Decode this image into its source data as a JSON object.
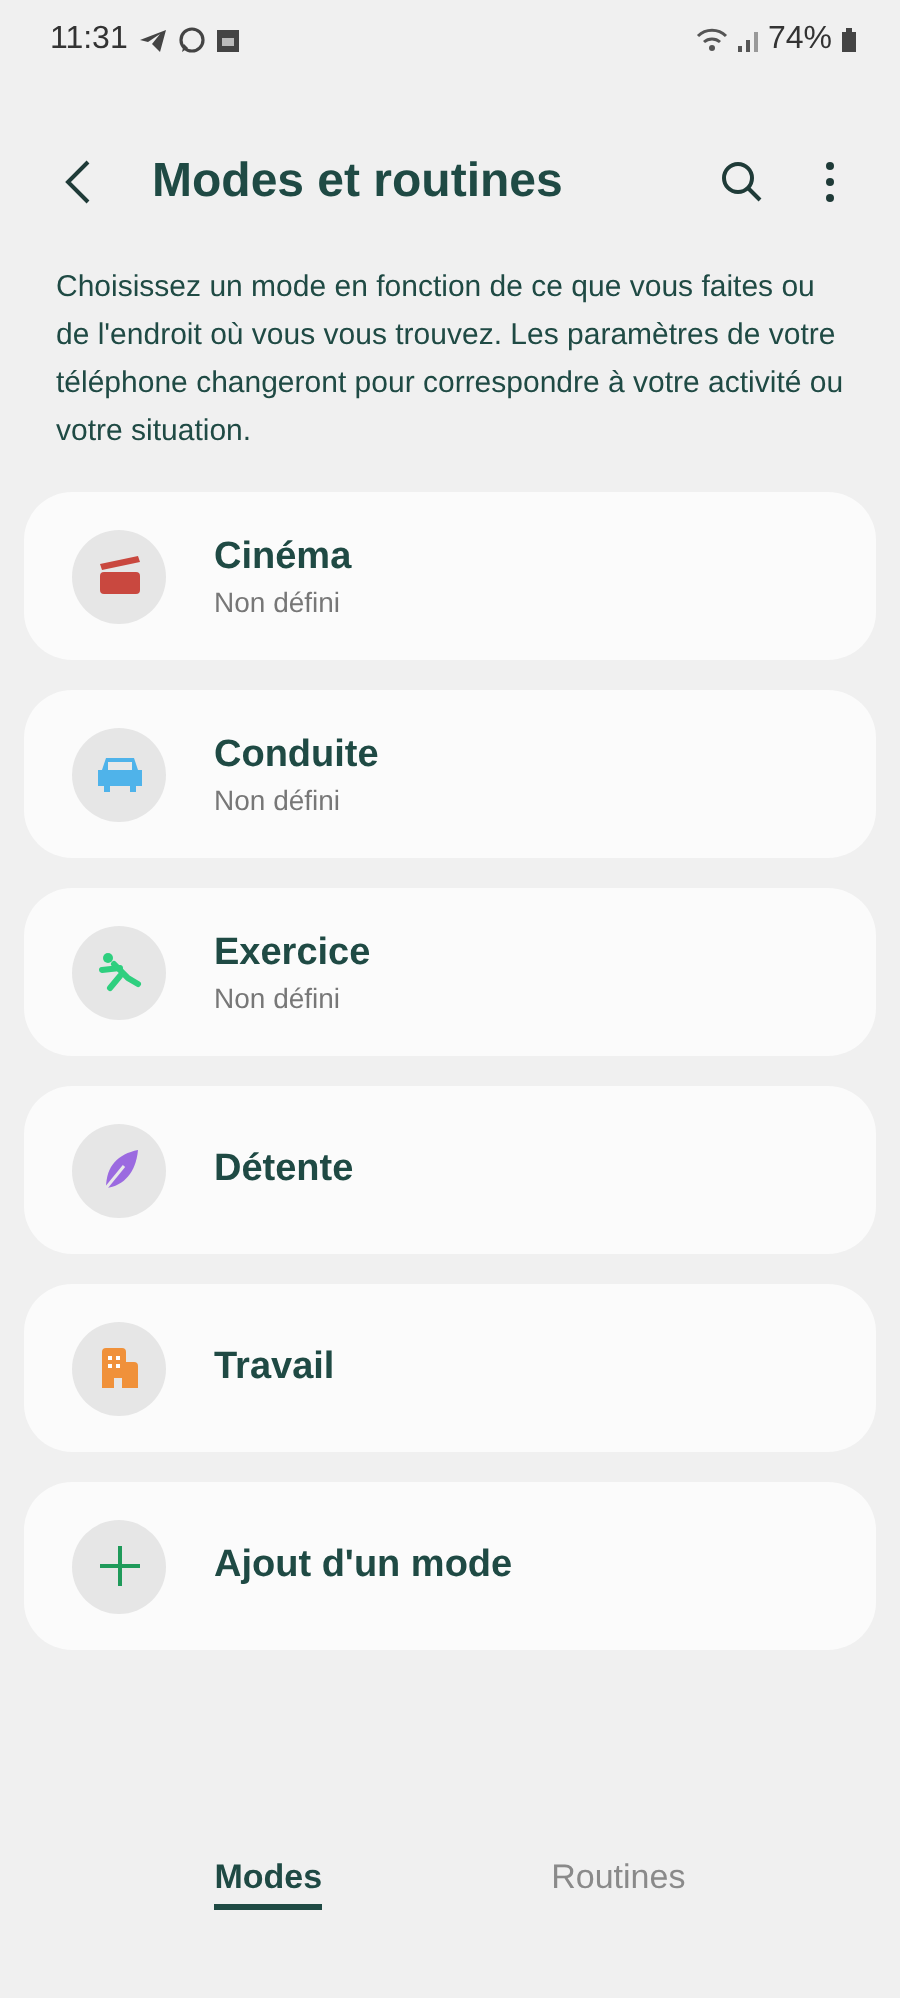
{
  "status_bar": {
    "time": "11:31",
    "battery": "74%"
  },
  "header": {
    "title": "Modes et routines"
  },
  "description": "Choisissez un mode en fonction de ce que vous faites ou de l'endroit où vous vous trouvez. Les paramètres de votre téléphone changeront pour correspondre à votre activité ou votre situation.",
  "modes": [
    {
      "kind": "cinema",
      "name": "Cinéma",
      "status": "Non défini",
      "color": "#c9483f"
    },
    {
      "kind": "car",
      "name": "Conduite",
      "status": "Non défini",
      "color": "#4fb3ea"
    },
    {
      "kind": "exercise",
      "name": "Exercice",
      "status": "Non défini",
      "color": "#2fcf7f"
    },
    {
      "kind": "leaf",
      "name": "Détente",
      "color": "#9b6ae0"
    },
    {
      "kind": "building",
      "name": "Travail",
      "color": "#f0913a"
    },
    {
      "kind": "add",
      "name": "Ajout d'un mode",
      "color": "#1f9a5a"
    }
  ],
  "tabs": [
    {
      "label": "Modes",
      "selected": true
    },
    {
      "label": "Routines",
      "selected": false
    }
  ]
}
